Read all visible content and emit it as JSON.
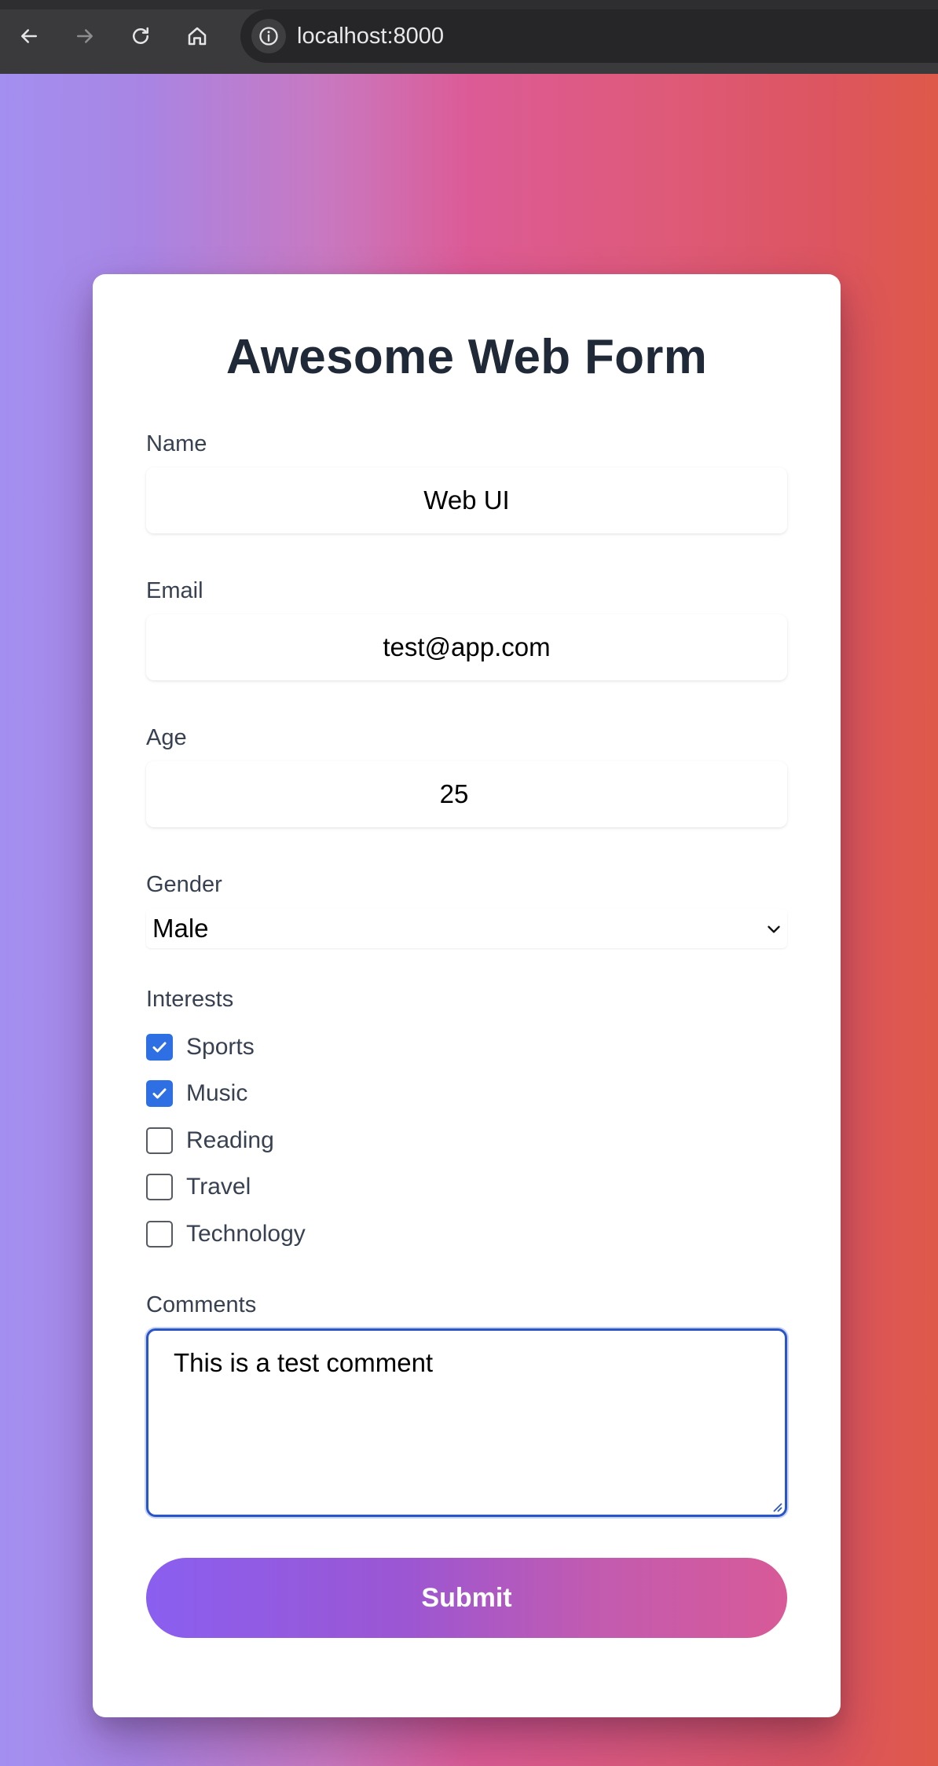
{
  "browser": {
    "url": "localhost:8000",
    "icons": {
      "back": "back-arrow-icon",
      "forward": "forward-arrow-icon",
      "reload": "reload-icon",
      "home": "home-icon",
      "site_info": "info-icon"
    }
  },
  "form": {
    "title": "Awesome Web Form",
    "name": {
      "label": "Name",
      "value": "Web UI"
    },
    "email": {
      "label": "Email",
      "value": "test@app.com"
    },
    "age": {
      "label": "Age",
      "value": "25"
    },
    "gender": {
      "label": "Gender",
      "selected": "Male"
    },
    "interests": {
      "label": "Interests",
      "options": [
        {
          "label": "Sports",
          "checked": true
        },
        {
          "label": "Music",
          "checked": true
        },
        {
          "label": "Reading",
          "checked": false
        },
        {
          "label": "Travel",
          "checked": false
        },
        {
          "label": "Technology",
          "checked": false
        }
      ]
    },
    "comments": {
      "label": "Comments",
      "value": "This is a test comment"
    },
    "submit_label": "Submit"
  },
  "colors": {
    "accent": "#2f6fe4",
    "title_text": "#1f2937",
    "label_text": "#374151",
    "focus_border": "#2a55c8",
    "button_gradient": [
      "#8a5ff0",
      "#d85a98"
    ]
  }
}
